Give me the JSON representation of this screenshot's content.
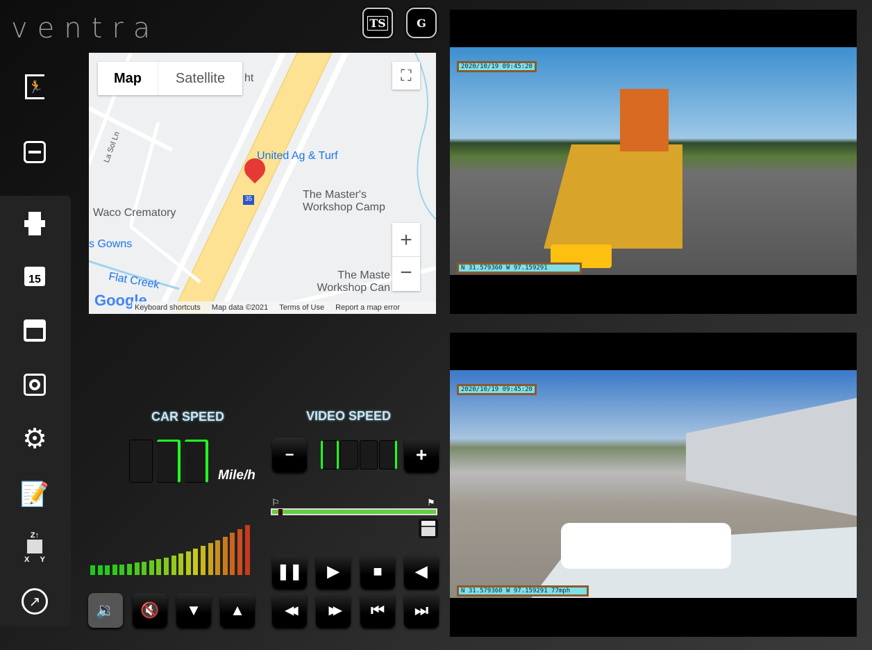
{
  "brand": {
    "logo_text": "ventra"
  },
  "topbar": {
    "ts_label": "TS",
    "g_label": "G"
  },
  "sidebar": {
    "items": [
      {
        "name": "exit",
        "icon": "exit-icon",
        "glyph": "🏃"
      },
      {
        "name": "minimize",
        "icon": "minus-icon",
        "glyph": "⊟"
      },
      {
        "name": "video",
        "icon": "film-icon",
        "glyph": "🎞"
      },
      {
        "name": "calendar",
        "icon": "calendar-icon",
        "glyph": "15"
      },
      {
        "name": "storage",
        "icon": "storage-icon",
        "glyph": "▤"
      },
      {
        "name": "snapshot",
        "icon": "camera-icon",
        "glyph": "◉"
      },
      {
        "name": "settings",
        "icon": "gear-icon",
        "glyph": "⚙"
      },
      {
        "name": "notes",
        "icon": "edit-icon",
        "glyph": "✎"
      },
      {
        "name": "gsensor",
        "icon": "xyz-axis-icon",
        "glyph": "⬛"
      },
      {
        "name": "compass",
        "icon": "compass-icon",
        "glyph": "🧭"
      }
    ]
  },
  "map": {
    "tab_map": "Map",
    "tab_satellite": "Satellite",
    "fullscreen": "⛶",
    "zoom_in": "+",
    "zoom_out": "−",
    "labels": {
      "poi1": "United Ag & Turf",
      "poi2_l1": "The Master's",
      "poi2_l2": "Workshop Camp",
      "poi3": "Waco Crematory",
      "poi4": "s Gowns",
      "creek": "Flat Creek",
      "road": "La Sol Ln",
      "poi5_l1": "The Maste",
      "poi5_l2": "Workshop Can",
      "ht": "ht",
      "shield": "35"
    },
    "footer": {
      "google": "Google",
      "shortcuts": "Keyboard shortcuts",
      "data": "Map data ©2021",
      "terms": "Terms of Use",
      "report": "Report a map error"
    }
  },
  "car_speed": {
    "title": "CAR SPEED",
    "unit": "Mile/h"
  },
  "video_speed": {
    "title": "VIDEO SPEED",
    "minus": "−",
    "plus": "+"
  },
  "playback": {
    "progress": 0.04
  },
  "volume": {
    "level": 1.0
  },
  "controls": {
    "pause": "❚❚",
    "play": "▶",
    "stop": "■",
    "reverse": "◀",
    "rewind": "◀◀",
    "fast_forward": "▶▶",
    "prev": "⏮",
    "next": "⏭",
    "speaker": "🔉",
    "mute": "🔇",
    "down": "▼",
    "up": "▲"
  },
  "cameras": [
    {
      "timestamp": "2020/10/19 09:45:20",
      "gps": "N 31.579360 W 97.159291"
    },
    {
      "timestamp": "2020/10/19 09:45:20",
      "gps": "N 31.579360 W 97.159291   77mph"
    }
  ]
}
